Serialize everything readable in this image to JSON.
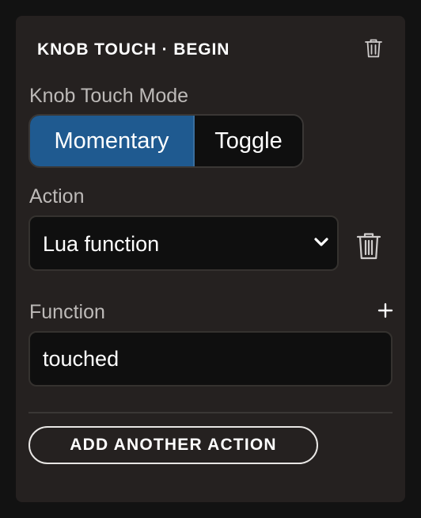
{
  "panel": {
    "title": "KNOB TOUCH · BEGIN",
    "delete_icon": "trash-icon"
  },
  "mode": {
    "label": "Knob Touch Mode",
    "options": [
      "Momentary",
      "Toggle"
    ],
    "selected": "Momentary"
  },
  "action": {
    "label": "Action",
    "selected_value": "Lua function",
    "dropdown_icon": "chevron-down-icon",
    "delete_icon": "trash-icon"
  },
  "function": {
    "label": "Function",
    "add_icon": "plus-icon",
    "value": "touched"
  },
  "footer": {
    "add_action_label": "ADD ANOTHER ACTION"
  },
  "colors": {
    "background": "#121212",
    "panel": "#252120",
    "accent": "#1f5a90",
    "field": "#0f0f0f",
    "label_text": "#bdbab8"
  }
}
